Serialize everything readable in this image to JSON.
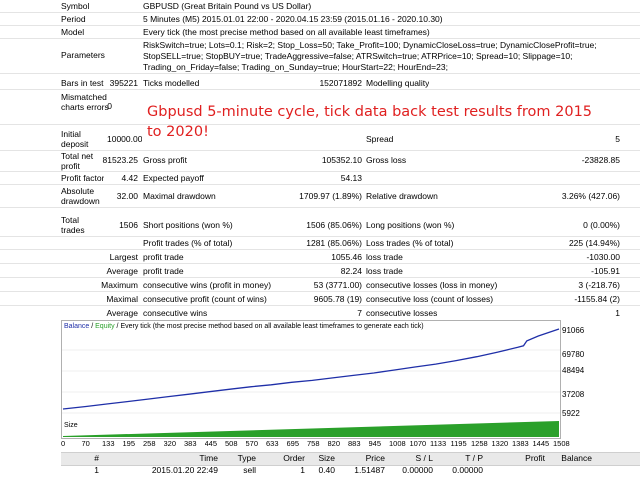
{
  "header": {
    "rows": [
      {
        "label": "Symbol",
        "value": "GBPUSD (Great Britain Pound vs US Dollar)"
      },
      {
        "label": "Period",
        "value": "5 Minutes (M5) 2015.01.01 22:00 - 2020.04.15 23:59 (2015.01.16 - 2020.10.30)"
      },
      {
        "label": "Model",
        "value": "Every tick (the most precise method based on all available least timeframes)"
      }
    ],
    "parameters_label": "Parameters",
    "parameters_lines": [
      "RiskSwitch=true; Lots=0.1; Risk=2; Stop_Loss=50; Take_Profit=100; DynamicCloseLoss=true; DynamicCloseProfit=true;",
      "StopSELL=true; StopBUY=true; TradeAggressive=false; ATRSwitch=true; ATRPrice=10; Spread=10; Slippage=10;",
      "Trading_on_Friday=false; Trading_on_Sunday=true; HourStart=22; HourEnd=23;"
    ]
  },
  "stats": {
    "bars_label": "Bars in test",
    "bars_value": "395221",
    "ticks_label": "Ticks modelled",
    "ticks_value": "152071892",
    "quality_label": "Modelling quality",
    "mismatched_label": "Mismatched charts errors",
    "mismatched_value": "0",
    "initial_label": "Initial deposit",
    "initial_value": "10000.00",
    "spread_label": "Spread",
    "spread_value": "5",
    "netprofit_label": "Total net profit",
    "netprofit_value": "81523.25",
    "grossprofit_label": "Gross profit",
    "grossprofit_value": "105352.10",
    "grossloss_label": "Gross loss",
    "grossloss_value": "-23828.85",
    "pf_label": "Profit factor",
    "pf_value": "4.42",
    "ep_label": "Expected payoff",
    "ep_value": "54.13",
    "absdd_label": "Absolute drawdown",
    "absdd_value": "32.00",
    "maxdd_label": "Maximal drawdown",
    "maxdd_value": "1709.97 (1.89%)",
    "reldd_label": "Relative drawdown",
    "reldd_value": "3.26% (427.06)",
    "tt_label": "Total trades",
    "tt_value": "1506",
    "sp_label": "Short positions (won %)",
    "sp_value": "1506 (85.06%)",
    "lp_label": "Long positions (won %)",
    "lp_value": "0 (0.00%)",
    "pt_label": "Profit trades (% of total)",
    "pt_value": "1281 (85.06%)",
    "lt_label": "Loss trades (% of total)",
    "lt_value": "225 (14.94%)",
    "largest_label": "Largest",
    "largest_pt_label": "profit trade",
    "largest_pt_value": "1055.46",
    "largest_lt_label": "loss trade",
    "largest_lt_value": "-1030.00",
    "average_label": "Average",
    "average_pt_label": "profit trade",
    "average_pt_value": "82.24",
    "average_lt_label": "loss trade",
    "average_lt_value": "-105.91",
    "maximum_label": "Maximum",
    "max_cw_label": "consecutive wins (profit in money)",
    "max_cw_value": "53 (3771.00)",
    "max_cl_label": "consecutive losses (loss in money)",
    "max_cl_value": "3 (-218.76)",
    "maximal_label": "Maximal",
    "mxl_cp_label": "consecutive profit (count of wins)",
    "mxl_cp_value": "9605.78 (19)",
    "mxl_cl_label": "consecutive loss (count of losses)",
    "mxl_cl_value": "-1155.84 (2)",
    "avg2_label": "Average",
    "avg_cw_label": "consecutive wins",
    "avg_cw_value": "7",
    "avg_cl_label": "consecutive losses",
    "avg_cl_value": "1"
  },
  "overlay_text": "Gbpusd 5-minute cycle, tick data back test results from 2015 to 2020!",
  "chart_legend": {
    "balance": "Balance",
    "sep": " / ",
    "equity": "Equity",
    "rest": " / Every tick (the most precise method based on all available least timeframes to generate each tick)"
  },
  "size_label": "Size",
  "colors": {
    "balance": "#1f2fa8",
    "equity": "#2aa02a",
    "overlay": "#e02020"
  },
  "chart_data": {
    "type": "line",
    "x_ticks": [
      "0",
      "70",
      "133",
      "195",
      "258",
      "320",
      "383",
      "445",
      "508",
      "570",
      "633",
      "695",
      "758",
      "820",
      "883",
      "945",
      "1008",
      "1070",
      "1133",
      "1195",
      "1258",
      "1320",
      "1383",
      "1445",
      "1508"
    ],
    "y_ticks": [
      "91066",
      "69780",
      "48494",
      "37208",
      "5922"
    ],
    "series": [
      {
        "name": "Balance",
        "x": [
          0,
          70,
          133,
          195,
          258,
          320,
          383,
          445,
          508,
          570,
          633,
          695,
          758,
          820,
          883,
          945,
          1008,
          1070,
          1133,
          1195,
          1258,
          1320,
          1383,
          1400,
          1410,
          1445,
          1508
        ],
        "y": [
          10000,
          12500,
          15000,
          17500,
          20000,
          22500,
          25000,
          27500,
          30000,
          32500,
          34500,
          37000,
          39000,
          41500,
          44000,
          46500,
          49500,
          52500,
          55500,
          59000,
          63000,
          67500,
          72500,
          74000,
          79000,
          84000,
          91066
        ]
      }
    ],
    "size_series_max": 1508
  },
  "trade_table": {
    "columns": [
      "#",
      "Time",
      "Type",
      "Order",
      "Size",
      "Price",
      "S / L",
      "T / P",
      "Profit",
      "Balance"
    ],
    "rows": [
      [
        "1",
        "2015.01.20 22:49",
        "sell",
        "1",
        "0.40",
        "1.51487",
        "0.00000",
        "0.00000",
        "",
        ""
      ]
    ]
  }
}
